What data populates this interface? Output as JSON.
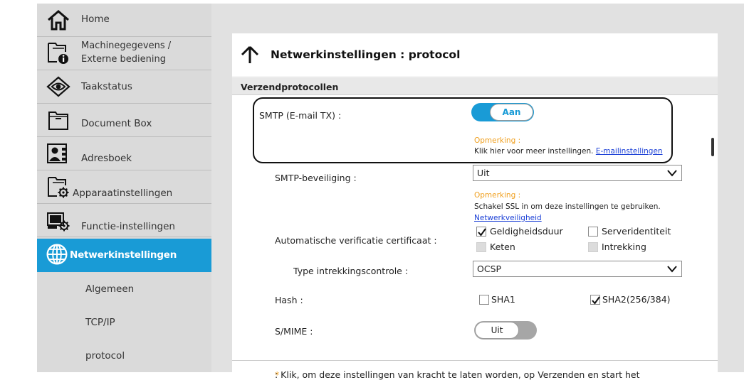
{
  "sidebar": {
    "items": [
      {
        "label": "Home",
        "icon": "home-icon"
      },
      {
        "label_line1": "Machinegegevens /",
        "label_line2": "Externe bediening",
        "icon": "device-info-icon"
      },
      {
        "label": "Taakstatus",
        "icon": "eye-icon"
      },
      {
        "label": "Document Box",
        "icon": "folder-icon"
      },
      {
        "label": "Adresboek",
        "icon": "address-book-icon"
      },
      {
        "label": "Apparaatinstellingen",
        "icon": "device-settings-icon"
      },
      {
        "label": "Functie-instellingen",
        "icon": "function-settings-icon"
      },
      {
        "label": "Netwerkinstellingen",
        "icon": "globe-icon",
        "active": true
      }
    ],
    "subitems": [
      "Algemeen",
      "TCP/IP",
      "protocol"
    ]
  },
  "page": {
    "title": "Netwerkinstellingen : protocol",
    "section": "Verzendprotocollen"
  },
  "smtp": {
    "label": "SMTP (E-mail TX) :",
    "toggle": "Aan",
    "note_heading": "Opmerking :",
    "note_text": "Klik hier voor meer instellingen.",
    "note_link": "E-mailinstellingen"
  },
  "smtp_security": {
    "label": "SMTP-beveiliging :",
    "value": "Uit",
    "note_heading": "Opmerking :",
    "note_text": "Schakel SSL in om deze instellingen te gebruiken.",
    "note_link": "Netwerkveiligheid"
  },
  "cert": {
    "label": "Automatische verificatie certificaat :",
    "options": [
      {
        "label": "Geldigheidsduur",
        "checked": true,
        "disabled": false
      },
      {
        "label": "Serveridentiteit",
        "checked": false,
        "disabled": false
      },
      {
        "label": "Keten",
        "checked": false,
        "disabled": true
      },
      {
        "label": "Intrekking",
        "checked": false,
        "disabled": true
      }
    ]
  },
  "revocation": {
    "label": "Type intrekkingscontrole :",
    "value": "OCSP"
  },
  "hash": {
    "label": "Hash :",
    "options": [
      {
        "label": "SHA1",
        "checked": false
      },
      {
        "label": "SHA2(256/384)",
        "checked": true
      }
    ]
  },
  "smime": {
    "label": "S/MIME :",
    "toggle": "Uit"
  },
  "footer": {
    "star": "*",
    "text": ": Klik, om deze instellingen van kracht te laten worden, op Verzenden en start het"
  },
  "colors": {
    "accent": "#199bd6",
    "note": "#f0a020",
    "link": "#1a3fd6"
  }
}
